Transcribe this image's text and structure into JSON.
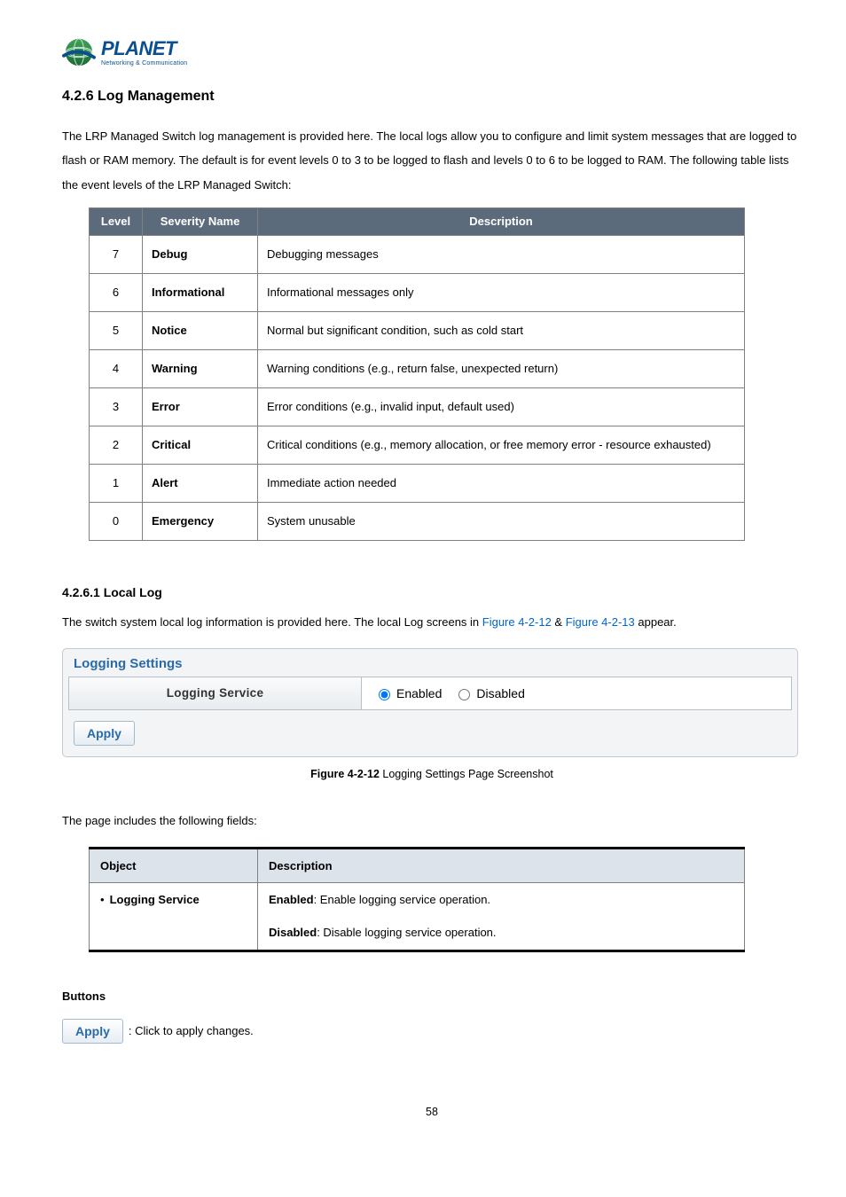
{
  "logo": {
    "word": "PLANET",
    "tagline": "Networking & Communication"
  },
  "section": {
    "heading": "4.2.6 Log Management",
    "intro": "The LRP Managed Switch log management is provided here. The local logs allow you to configure and limit system messages that are logged to flash or RAM memory. The default is for event levels 0 to 3 to be logged to flash and levels 0 to 6 to be logged to RAM. The following table lists the event levels of the LRP Managed Switch:"
  },
  "severity_table": {
    "headers": {
      "level": "Level",
      "name": "Severity Name",
      "desc": "Description"
    },
    "rows": [
      {
        "level": "7",
        "name": "Debug",
        "desc": "Debugging messages"
      },
      {
        "level": "6",
        "name": "Informational",
        "desc": "Informational messages only"
      },
      {
        "level": "5",
        "name": "Notice",
        "desc": "Normal but significant condition, such as cold start"
      },
      {
        "level": "4",
        "name": "Warning",
        "desc": "Warning conditions (e.g., return false, unexpected return)"
      },
      {
        "level": "3",
        "name": "Error",
        "desc": "Error conditions (e.g., invalid input, default used)"
      },
      {
        "level": "2",
        "name": "Critical",
        "desc": "Critical conditions (e.g., memory allocation, or free memory error - resource exhausted)"
      },
      {
        "level": "1",
        "name": "Alert",
        "desc": "Immediate action needed"
      },
      {
        "level": "0",
        "name": "Emergency",
        "desc": "System unusable"
      }
    ]
  },
  "subsection": {
    "heading": "4.2.6.1 Local Log",
    "intro_pre": "The switch system local log information is provided here. The local Log screens in ",
    "fig_link_1": "Figure 4-2-12",
    "amp": " & ",
    "fig_link_2": "Figure 4-2-13",
    "intro_post": " appear."
  },
  "panel": {
    "title": "Logging Settings",
    "row_label": "Logging Service",
    "enabled": "Enabled",
    "disabled": "Disabled",
    "apply": "Apply"
  },
  "figure_caption": {
    "bold": "Figure 4-2-12",
    "rest": " Logging Settings Page Screenshot"
  },
  "fields_intro": "The page includes the following fields:",
  "objdesc_table": {
    "headers": {
      "object": "Object",
      "desc": "Description"
    },
    "row": {
      "object": "Logging Service",
      "enabled_b": "Enabled",
      "enabled_rest": ": Enable logging service operation.",
      "disabled_b": "Disabled",
      "disabled_rest": ": Disable logging service operation."
    }
  },
  "buttons": {
    "heading": "Buttons",
    "apply": "Apply",
    "apply_desc": ": Click to apply changes."
  },
  "page_number": "58"
}
